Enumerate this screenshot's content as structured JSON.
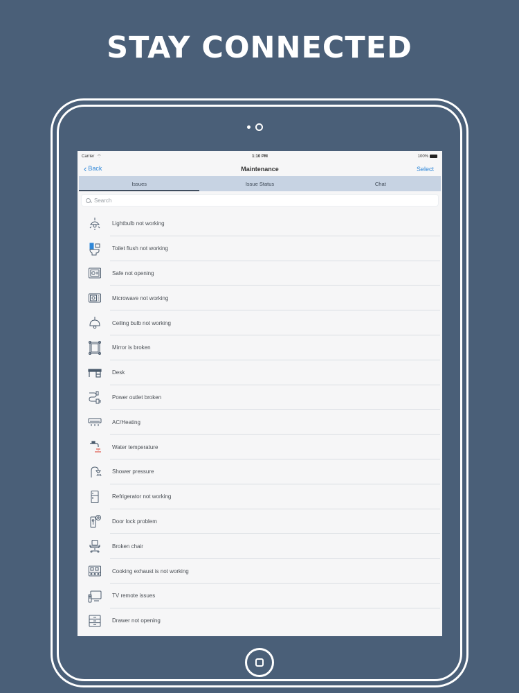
{
  "headline": "STAY CONNECTED",
  "status_bar": {
    "carrier": "Carrier",
    "time": "1:10 PM",
    "battery": "100%"
  },
  "nav": {
    "back_label": "Back",
    "title": "Maintenance",
    "select_label": "Select"
  },
  "tabs": [
    {
      "label": "Issues",
      "active": true
    },
    {
      "label": "Issue Status",
      "active": false
    },
    {
      "label": "Chat",
      "active": false
    }
  ],
  "search": {
    "placeholder": "Search"
  },
  "issues": [
    {
      "label": "Lightbulb not working",
      "icon": "lightbulb-icon"
    },
    {
      "label": "Toilet flush not working",
      "icon": "toilet-icon"
    },
    {
      "label": "Safe not opening",
      "icon": "safe-icon"
    },
    {
      "label": "Microwave not working",
      "icon": "microwave-icon"
    },
    {
      "label": "Ceiling bulb not working",
      "icon": "ceiling-lamp-icon"
    },
    {
      "label": "Mirror is broken",
      "icon": "mirror-icon"
    },
    {
      "label": "Desk",
      "icon": "desk-icon"
    },
    {
      "label": "Power outlet broken",
      "icon": "power-outlet-icon"
    },
    {
      "label": "AC/Heating",
      "icon": "air-conditioner-icon"
    },
    {
      "label": "Water temperature",
      "icon": "faucet-icon"
    },
    {
      "label": "Shower pressure",
      "icon": "shower-icon"
    },
    {
      "label": "Refrigerator not working",
      "icon": "refrigerator-icon"
    },
    {
      "label": "Door lock problem",
      "icon": "door-lock-icon"
    },
    {
      "label": "Broken chair",
      "icon": "chair-icon"
    },
    {
      "label": "Cooking exhaust is not working",
      "icon": "exhaust-hood-icon"
    },
    {
      "label": "TV remote issues",
      "icon": "tv-remote-icon"
    },
    {
      "label": "Drawer not opening",
      "icon": "drawer-icon"
    }
  ],
  "colors": {
    "background": "#4a5f78",
    "accent": "#2f87d8",
    "tab_bar": "#c7d3e3"
  }
}
